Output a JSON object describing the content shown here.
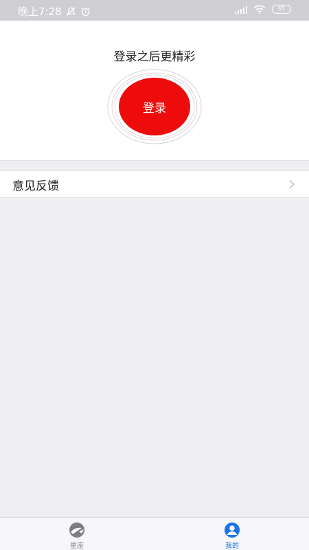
{
  "status_bar": {
    "time": "晚上7:28",
    "battery": "65"
  },
  "login": {
    "heading": "登录之后更精彩",
    "button_label": "登录"
  },
  "settings": {
    "feedback_label": "意见反馈",
    "chevron": ">"
  },
  "tab_bar": {
    "tabs": [
      {
        "label": "星座",
        "icon": "constellation-icon",
        "active": false,
        "color": "#8a8a8e"
      },
      {
        "label": "我的",
        "icon": "user-icon",
        "active": true,
        "color": "#1a73e8"
      }
    ]
  },
  "colors": {
    "accent_red": "#ee0b0b",
    "accent_blue": "#1a73e8",
    "background": "#efeef3"
  }
}
